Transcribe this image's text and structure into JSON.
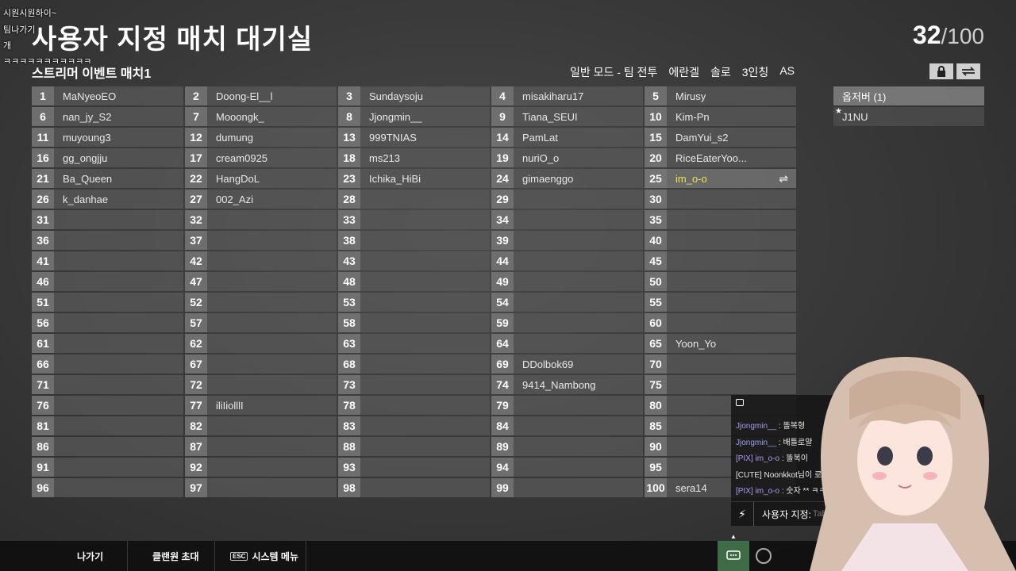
{
  "overlay": [
    "시원시원하이~",
    "팀나가기",
    "개",
    "ㅋㅋㅋㅋㅋㅋㅋㅋㅋㅋㅋ"
  ],
  "header": {
    "title": "사용자 지정 매치 대기실",
    "count_current": "32",
    "count_max": "/100",
    "room_name": "스트리머 이벤트 매치1"
  },
  "modes": [
    "일반 모드 - 팀 전투",
    "에란겔",
    "솔로",
    "3인칭",
    "AS"
  ],
  "slots": [
    {
      "n": "1",
      "name": "MaNyeoEO"
    },
    {
      "n": "2",
      "name": "Doong-El__l"
    },
    {
      "n": "3",
      "name": "Sundaysoju"
    },
    {
      "n": "4",
      "name": "misakiharu17"
    },
    {
      "n": "5",
      "name": "Mirusy"
    },
    {
      "n": "6",
      "name": "nan_jy_S2"
    },
    {
      "n": "7",
      "name": "Mooongk_"
    },
    {
      "n": "8",
      "name": "Jjongmin__"
    },
    {
      "n": "9",
      "name": "Tiana_SEUI"
    },
    {
      "n": "10",
      "name": "Kim-Pn"
    },
    {
      "n": "11",
      "name": "muyoung3"
    },
    {
      "n": "12",
      "name": "dumung"
    },
    {
      "n": "13",
      "name": "999TNIAS"
    },
    {
      "n": "14",
      "name": "PamLat"
    },
    {
      "n": "15",
      "name": "DamYui_s2"
    },
    {
      "n": "16",
      "name": "gg_ongjju"
    },
    {
      "n": "17",
      "name": "cream0925"
    },
    {
      "n": "18",
      "name": "ms213"
    },
    {
      "n": "19",
      "name": "nuriO_o"
    },
    {
      "n": "20",
      "name": "RiceEaterYoo..."
    },
    {
      "n": "21",
      "name": "Ba_Queen"
    },
    {
      "n": "22",
      "name": "HangDoL"
    },
    {
      "n": "23",
      "name": "Ichika_HiBi"
    },
    {
      "n": "24",
      "name": "gimaenggo"
    },
    {
      "n": "25",
      "name": "im_o-o",
      "self": true
    },
    {
      "n": "26",
      "name": "k_danhae"
    },
    {
      "n": "27",
      "name": "002_Azi"
    },
    {
      "n": "28",
      "name": ""
    },
    {
      "n": "29",
      "name": ""
    },
    {
      "n": "30",
      "name": ""
    },
    {
      "n": "31",
      "name": ""
    },
    {
      "n": "32",
      "name": ""
    },
    {
      "n": "33",
      "name": ""
    },
    {
      "n": "34",
      "name": ""
    },
    {
      "n": "35",
      "name": ""
    },
    {
      "n": "36",
      "name": ""
    },
    {
      "n": "37",
      "name": ""
    },
    {
      "n": "38",
      "name": ""
    },
    {
      "n": "39",
      "name": ""
    },
    {
      "n": "40",
      "name": ""
    },
    {
      "n": "41",
      "name": ""
    },
    {
      "n": "42",
      "name": ""
    },
    {
      "n": "43",
      "name": ""
    },
    {
      "n": "44",
      "name": ""
    },
    {
      "n": "45",
      "name": ""
    },
    {
      "n": "46",
      "name": ""
    },
    {
      "n": "47",
      "name": ""
    },
    {
      "n": "48",
      "name": ""
    },
    {
      "n": "49",
      "name": ""
    },
    {
      "n": "50",
      "name": ""
    },
    {
      "n": "51",
      "name": ""
    },
    {
      "n": "52",
      "name": ""
    },
    {
      "n": "53",
      "name": ""
    },
    {
      "n": "54",
      "name": ""
    },
    {
      "n": "55",
      "name": ""
    },
    {
      "n": "56",
      "name": ""
    },
    {
      "n": "57",
      "name": ""
    },
    {
      "n": "58",
      "name": ""
    },
    {
      "n": "59",
      "name": ""
    },
    {
      "n": "60",
      "name": ""
    },
    {
      "n": "61",
      "name": ""
    },
    {
      "n": "62",
      "name": ""
    },
    {
      "n": "63",
      "name": ""
    },
    {
      "n": "64",
      "name": ""
    },
    {
      "n": "65",
      "name": "Yoon_Yo"
    },
    {
      "n": "66",
      "name": ""
    },
    {
      "n": "67",
      "name": ""
    },
    {
      "n": "68",
      "name": ""
    },
    {
      "n": "69",
      "name": "DDolbok69"
    },
    {
      "n": "70",
      "name": ""
    },
    {
      "n": "71",
      "name": ""
    },
    {
      "n": "72",
      "name": ""
    },
    {
      "n": "73",
      "name": ""
    },
    {
      "n": "74",
      "name": "9414_Nambong"
    },
    {
      "n": "75",
      "name": ""
    },
    {
      "n": "76",
      "name": ""
    },
    {
      "n": "77",
      "name": "iliIiolllI"
    },
    {
      "n": "78",
      "name": ""
    },
    {
      "n": "79",
      "name": ""
    },
    {
      "n": "80",
      "name": ""
    },
    {
      "n": "81",
      "name": ""
    },
    {
      "n": "82",
      "name": ""
    },
    {
      "n": "83",
      "name": ""
    },
    {
      "n": "84",
      "name": ""
    },
    {
      "n": "85",
      "name": ""
    },
    {
      "n": "86",
      "name": ""
    },
    {
      "n": "87",
      "name": ""
    },
    {
      "n": "88",
      "name": ""
    },
    {
      "n": "89",
      "name": ""
    },
    {
      "n": "90",
      "name": ""
    },
    {
      "n": "91",
      "name": ""
    },
    {
      "n": "92",
      "name": ""
    },
    {
      "n": "93",
      "name": ""
    },
    {
      "n": "94",
      "name": ""
    },
    {
      "n": "95",
      "name": ""
    },
    {
      "n": "96",
      "name": ""
    },
    {
      "n": "97",
      "name": ""
    },
    {
      "n": "98",
      "name": ""
    },
    {
      "n": "99",
      "name": ""
    },
    {
      "n": "100",
      "name": "sera14"
    }
  ],
  "observers": {
    "header": "옵저버 (1)",
    "list": [
      "J1NU"
    ]
  },
  "chat": {
    "lines": [
      {
        "tag": "",
        "who": "Jjongmin__",
        "text": " : 똘복형"
      },
      {
        "tag": "",
        "who": "Jjongmin__",
        "text": " : 배틀로얄"
      },
      {
        "tag": "[PIX]",
        "who": " im_o-o",
        "text": " : 똘복이"
      },
      {
        "tag": "",
        "who": "",
        "text": "[CUTE] Noonkkot님이 로"
      },
      {
        "tag": "[PIX]",
        "who": " im_o-o",
        "text": " : 숫자 ** ㅋㅋ"
      }
    ],
    "input_label": "사용자 지정:",
    "input_placeholder": "Tab S"
  },
  "bottom": {
    "exit": "나가기",
    "invite": "클랜원 초대",
    "esc_key": "ESC",
    "system_menu": "시스템 메뉴"
  },
  "colors": {
    "self_name": "#f2e24a",
    "chat_active": "#3f6b46"
  }
}
